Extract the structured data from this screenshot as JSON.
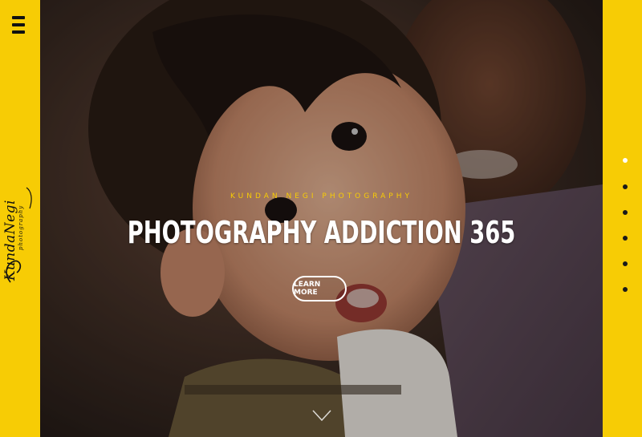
{
  "colors": {
    "accent": "#f7cc05",
    "dark": "#111111",
    "white": "#ffffff"
  },
  "sidebar": {
    "menu_icon": "hamburger-menu-icon",
    "logo": {
      "main": "KundaNegi",
      "sub": "photography"
    }
  },
  "hero": {
    "subtitle": "KUNDAN NEGI PHOTOGRAPHY",
    "title": "PHOTOGRAPHY ADDICTION 365",
    "cta_label": "LEARN MORE",
    "scroll_icon": "chevron-down-icon"
  },
  "pager": {
    "dots": 6,
    "active_index": 0
  }
}
